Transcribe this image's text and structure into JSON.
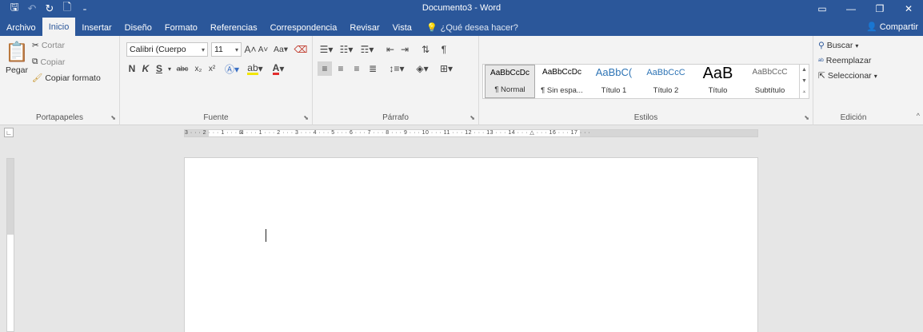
{
  "window": {
    "title": "Documento3 - Word",
    "qat_icons": [
      "save-icon",
      "undo-icon",
      "redo-icon",
      "new-document-icon",
      "customize-qat-icon"
    ],
    "controls": [
      "ribbon-display-icon",
      "minimize-icon",
      "maximize-icon",
      "close-icon"
    ]
  },
  "tabs": [
    "Archivo",
    "Inicio",
    "Insertar",
    "Diseño",
    "Formato",
    "Referencias",
    "Correspondencia",
    "Revisar",
    "Vista"
  ],
  "active_tab": "Inicio",
  "tellme": "¿Qué desea hacer?",
  "share": "Compartir",
  "clipboard": {
    "paste": "Pegar",
    "cut": "Cortar",
    "copy": "Copiar",
    "format_painter": "Copiar formato",
    "label": "Portapapeles"
  },
  "font": {
    "family": "Calibri (Cuerpo",
    "size": "11",
    "change_case": "Aa",
    "bold": "N",
    "italic": "K",
    "underline": "S",
    "strike": "abc",
    "subscript": "x₂",
    "superscript": "x²",
    "label": "Fuente"
  },
  "paragraph": {
    "label": "Párrafo"
  },
  "styles": {
    "label": "Estilos",
    "items": [
      {
        "sample": "AaBbCcDc",
        "name": "¶ Normal"
      },
      {
        "sample": "AaBbCcDc",
        "name": "¶ Sin espa..."
      },
      {
        "sample": "AaBbC(",
        "name": "Título 1"
      },
      {
        "sample": "AaBbCcC",
        "name": "Título 2"
      },
      {
        "sample": "AaB",
        "name": "Título"
      },
      {
        "sample": "AaBbCcC",
        "name": "Subtítulo"
      }
    ]
  },
  "editing": {
    "find": "Buscar",
    "replace": "Reemplazar",
    "select": "Seleccionar",
    "label": "Edición"
  },
  "ruler": {
    "numbers": "3 · · · 2 · · · 1 · · · ⊠ · · · 1 · · · 2 · · · 3 · · · 4 · · · 5 · · · 6 · · · 7 · · · 8 · · · 9 · · · 10 · · · 11 · · · 12 · · · 13 · · · 14 · · · △ · · · 16 · · · 17 · · ·"
  },
  "colors": {
    "title_bar": "#2b579a",
    "ribbon": "#f3f3f3",
    "canvas": "#e6e6e6"
  }
}
